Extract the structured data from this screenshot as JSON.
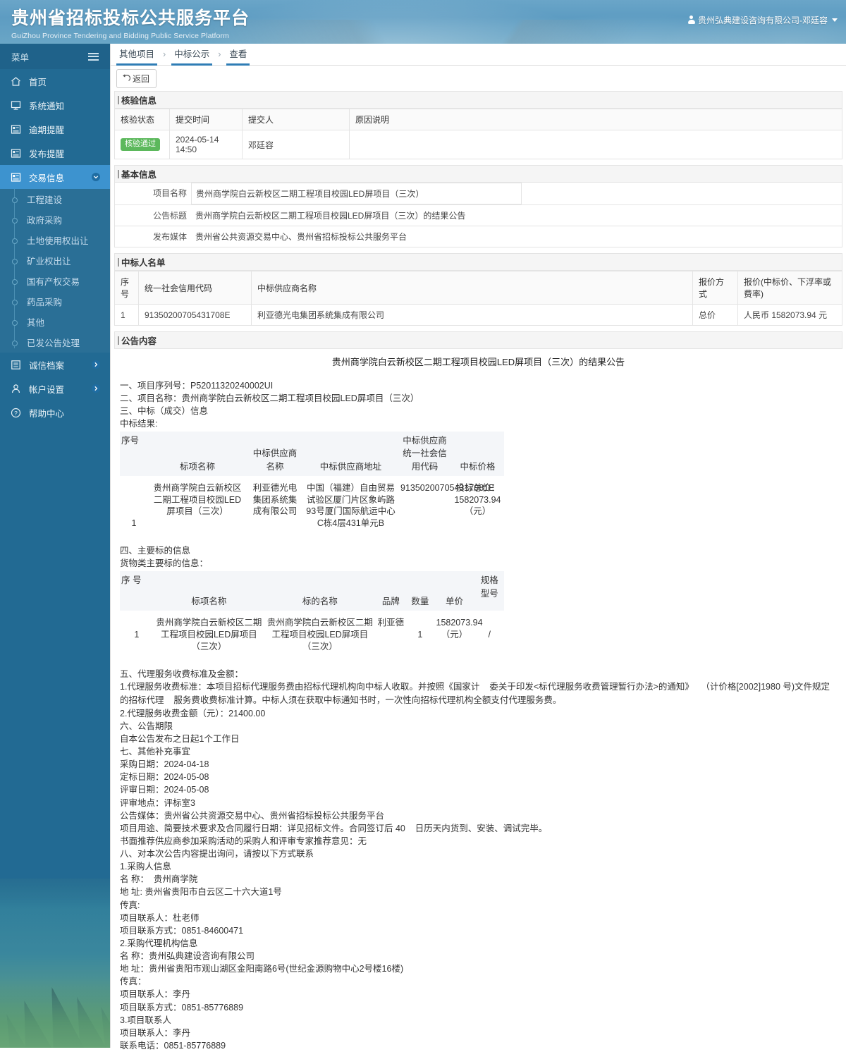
{
  "header": {
    "brand_cn": "贵州省招标投标公共服务平台",
    "brand_en": "GuiZhou Province Tendering and Bidding Public Service Platform",
    "user": "贵州弘典建设咨询有限公司-邓廷容"
  },
  "sidebar": {
    "menu_label": "菜单",
    "items": [
      {
        "label": "首页",
        "icon": "home-icon"
      },
      {
        "label": "系统通知",
        "icon": "monitor-icon"
      },
      {
        "label": "逾期提醒",
        "icon": "doc-icon"
      },
      {
        "label": "发布提醒",
        "icon": "doc-icon"
      },
      {
        "label": "交易信息",
        "icon": "doc-icon",
        "active": true,
        "arrow": "chevron-down-icon"
      }
    ],
    "sub_items": [
      {
        "label": "工程建设"
      },
      {
        "label": "政府采购"
      },
      {
        "label": "土地使用权出让"
      },
      {
        "label": "矿业权出让"
      },
      {
        "label": "国有产权交易"
      },
      {
        "label": "药品采购"
      },
      {
        "label": "其他"
      },
      {
        "label": "已发公告处理"
      }
    ],
    "items_bottom": [
      {
        "label": "诚信档案",
        "icon": "archive-icon",
        "arrow": "chevron-right-icon"
      },
      {
        "label": "帐户设置",
        "icon": "user-icon",
        "arrow": "chevron-right-icon"
      },
      {
        "label": "帮助中心",
        "icon": "help-icon"
      }
    ]
  },
  "breadcrumb": {
    "items": [
      "其他项目",
      "中标公示",
      "查看"
    ],
    "separator": "›"
  },
  "toolbar": {
    "back_label": "返回"
  },
  "verify": {
    "section_title": "核验信息",
    "columns": [
      "核验状态",
      "提交时间",
      "提交人",
      "原因说明"
    ],
    "rows": [
      {
        "status": "核验通过",
        "time": "2024-05-14 14:50",
        "person": "邓廷容",
        "reason": ""
      }
    ]
  },
  "basic": {
    "section_title": "基本信息",
    "fields": [
      {
        "label": "项目名称",
        "value": "贵州商学院白云新校区二期工程项目校园LED屏项目（三次）"
      },
      {
        "label": "公告标题",
        "value": "贵州商学院白云新校区二期工程项目校园LED屏项目（三次）的结果公告"
      },
      {
        "label": "发布媒体",
        "value": "贵州省公共资源交易中心、贵州省招标投标公共服务平台"
      }
    ]
  },
  "winners": {
    "section_title": "中标人名单",
    "columns": [
      "序号",
      "统一社会信用代码",
      "中标供应商名称",
      "报价方式",
      "报价(中标价、下浮率或费率)"
    ],
    "rows": [
      {
        "no": "1",
        "credit_code": "91350200705431708E",
        "supplier": "利亚德光电集团系统集成有限公司",
        "quote_type": "总价",
        "quote": "人民币 1582073.94 元"
      }
    ]
  },
  "announcement": {
    "section_title": "公告内容",
    "title": "贵州商学院白云新校区二期工程项目校园LED屏项目（三次）的结果公告",
    "lines_1": [
      "一、项目序列号：P52011320240002UI",
      "二、项目名称：贵州商学院白云新校区二期工程项目校园LED屏项目（三次）",
      "三、中标（成交）信息",
      "中标结果:"
    ],
    "result_table": {
      "columns": [
        "序号",
        "标项名称",
        "中标供应商名称",
        "中标供应商地址",
        "中标供应商统一社会信用代码",
        "中标价格"
      ],
      "rows": [
        {
          "no": "1",
          "lot_name": "贵州商学院白云新校区二期工程项目校园LED屏项目（三次）",
          "supplier": "利亚德光电集团系统集成有限公司",
          "address": "中国（福建）自由贸易试验区厦门片区象屿路93号厦门国际航运中心C栋4层431单元B",
          "credit_code": "913502007054317081E",
          "price": "投标总价：1582073.94（元）"
        }
      ]
    },
    "lines_2": [
      "四、主要标的信息",
      "货物类主要标的信息："
    ],
    "goods_table": {
      "columns": [
        "序    号",
        "标项名称",
        "标的名称",
        "品牌",
        "数量",
        "单价",
        "规格型号"
      ],
      "rows": [
        {
          "no": "1",
          "lot_name": "贵州商学院白云新校区二期工程项目校园LED屏项目（三次）",
          "item_name": "贵州商学院白云新校区二期工程项目校园LED屏项目（三次）",
          "brand": "利亚德",
          "qty": "1",
          "price": "1582073.94（元）",
          "model": "/"
        }
      ]
    },
    "lines_3": [
      "五、代理服务收费标准及金额：",
      "1.代理服务收费标准：本项目招标代理服务费由招标代理机构向中标人收取。并按照《国家计    委关于印发<标代理服务收费管理暂行办法>的通知》   （计价格[2002]1980 号)文件规定的招标代理    服务费收费标准计算。中标人须在获取中标通知书时，一次性向招标代理机构全额支付代理服务费。",
      "2.代理服务收费金额（元）：21400.00",
      "六、公告期限",
      "自本公告发布之日起1个工作日",
      "七、其他补充事宜",
      "采购日期：2024-04-18",
      "定标日期：2024-05-08",
      "评审日期：2024-05-08",
      "评审地点：评标室3",
      "公告媒体：贵州省公共资源交易中心、贵州省招标投标公共服务平台",
      "项目用途、简要技术要求及合同履行日期：详见招标文件。合同签订后 40    日历天内货到、安装、调试完毕。",
      "书面推荐供应商参加采购活动的采购人和评审专家推荐意见：无",
      "八、对本次公告内容提出询问，请按以下方式联系",
      "1.采购人信息",
      "名 称：  贵州商学院",
      "地 址: 贵州省贵阳市白云区二十六大道1号",
      "传真:",
      "项目联系人：杜老师",
      "项目联系方式：0851-84600471",
      "2.采购代理机构信息",
      "名 称：贵州弘典建设咨询有限公司",
      "地 址：贵州省贵阳市观山湖区金阳南路6号(世纪金源购物中心2号楼16楼)",
      "传真：",
      "项目联系人：李丹",
      "项目联系方式：0851-85776889",
      "3.项目联系人",
      "项目联系人：李丹",
      "联系电话：0851-85776889"
    ]
  },
  "colors": {
    "header_blue": "#5d9cc2",
    "sidebar_blue": "#226a93",
    "sidebar_active": "#3d93cf",
    "crumb_underline": "#2f7db5",
    "badge_green": "#5cb85c"
  }
}
